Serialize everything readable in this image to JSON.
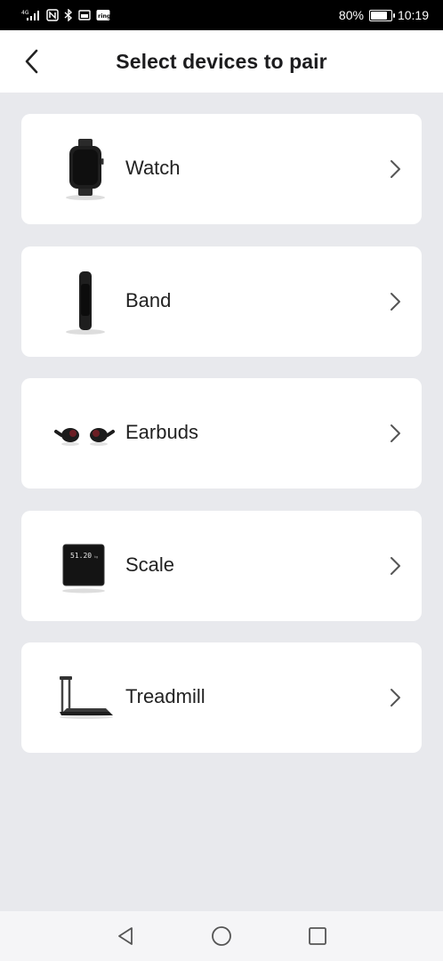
{
  "status_bar": {
    "network": "4G",
    "battery_percent": "80%",
    "battery_level": 0.8,
    "time": "10:19",
    "icons": [
      "signal-icon",
      "nfc-icon",
      "bluetooth-icon",
      "screen-icon",
      "ring-icon"
    ]
  },
  "header": {
    "title": "Select devices to pair",
    "back_icon": "chevron-left-icon"
  },
  "devices": [
    {
      "label": "Watch",
      "icon": "watch-icon"
    },
    {
      "label": "Band",
      "icon": "band-icon"
    },
    {
      "label": "Earbuds",
      "icon": "earbuds-icon"
    },
    {
      "label": "Scale",
      "icon": "scale-icon",
      "scale_display": "51.20"
    },
    {
      "label": "Treadmill",
      "icon": "treadmill-icon"
    }
  ],
  "nav_bar": {
    "buttons": [
      "back-triangle-icon",
      "home-circle-icon",
      "recents-square-icon"
    ]
  }
}
